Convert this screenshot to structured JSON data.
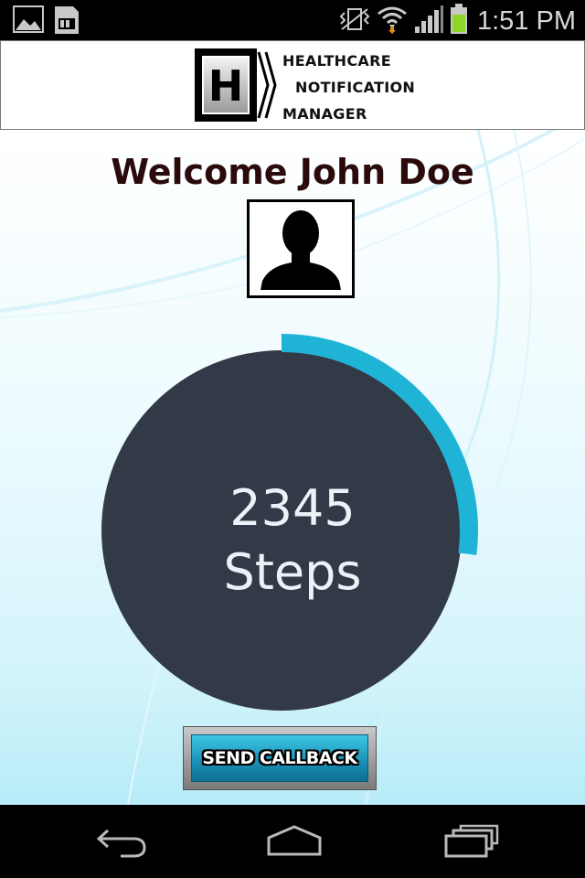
{
  "status_bar": {
    "time": "1:51 PM",
    "left_icons": [
      "image-icon",
      "sd-card-icon"
    ],
    "right_icons": [
      "vibrate-icon",
      "wifi-icon",
      "signal-icon",
      "battery-icon"
    ],
    "battery_color": "#8fd62a"
  },
  "header": {
    "logo_letter": "H",
    "line1": "HEALTHCARE",
    "line2": "NOTIFICATION",
    "line3": "MANAGER"
  },
  "main": {
    "welcome": "Welcome John Doe",
    "steps_value": "2345",
    "steps_unit": "Steps",
    "progress_fraction": 0.27,
    "progress_color": "#1fb4d6",
    "circle_color": "#333a47",
    "callback_label": "SEND CALLBACK"
  },
  "nav_bar": {
    "buttons": [
      "back-icon",
      "home-icon",
      "recent-apps-icon"
    ]
  }
}
